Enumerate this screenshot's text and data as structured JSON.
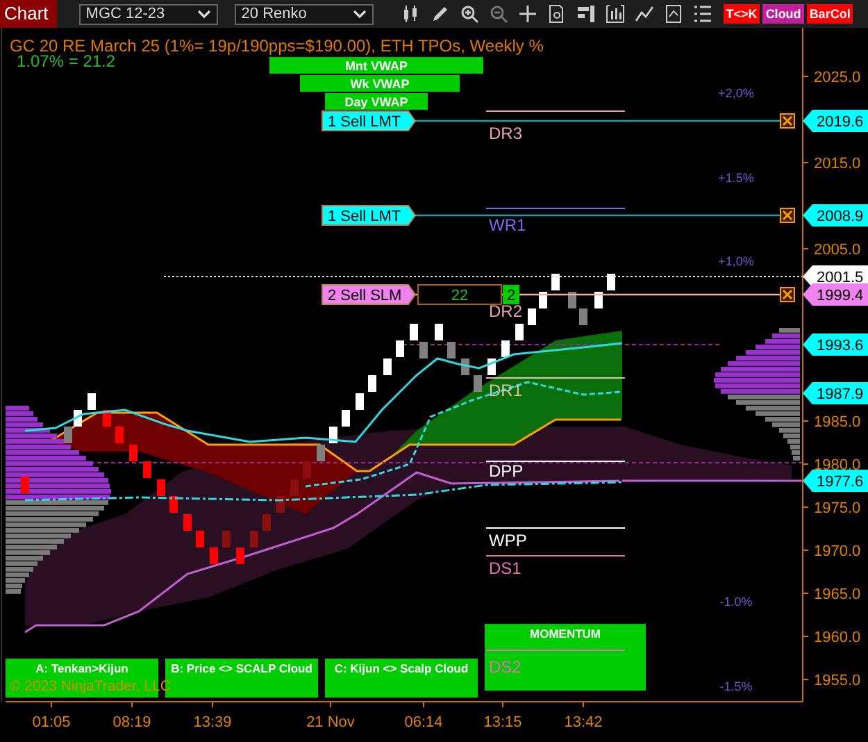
{
  "toolbar": {
    "title": "Chart",
    "instrument": "MGC 12-23",
    "bar_type": "20 Renko",
    "toggles": [
      {
        "label": "T<>K",
        "color": "#ff0000"
      },
      {
        "label": "Cloud",
        "color": "#c0209a"
      },
      {
        "label": "BarCol",
        "color": "#ff0000"
      }
    ]
  },
  "chart": {
    "header": "GC 20 RE March 25 (1%= 19p/190pps=$190.00), ETH TPOs, Weekly %",
    "subheader": "1.07% = 21.2",
    "vwap_labels": [
      "Mnt VWAP",
      "Wk VWAP",
      "Day VWAP"
    ],
    "orders": [
      {
        "label": "1 Sell LMT",
        "kind": "limit"
      },
      {
        "label": "1 Sell LMT",
        "kind": "limit"
      },
      {
        "label": "2 Sell SLM",
        "kind": "stop",
        "quantity": "22",
        "count": "2"
      }
    ],
    "pivots": [
      {
        "label": "DR3",
        "color": "#e8a0b0"
      },
      {
        "label": "WR1",
        "color": "#7b68ee"
      },
      {
        "label": "DR2",
        "color": "#e8a0b0"
      },
      {
        "label": "DR1",
        "color": "#e0c0a8"
      },
      {
        "label": "DPP",
        "color": "#ffffff"
      },
      {
        "label": "WPP",
        "color": "#ffffff"
      },
      {
        "label": "DS1",
        "color": "#e070b0"
      },
      {
        "label": "DS2",
        "color": "#e070b0"
      }
    ],
    "percent_labels": [
      "+2,0%",
      "+1.5%",
      "+1,0%",
      "-1.0%",
      "-1.5%"
    ],
    "signals": [
      "A: Tenkan>Kijun",
      "B: Price <> SCALP Cloud",
      "C: Kijun <> Scalp Cloud",
      "MOMENTUM"
    ],
    "copyright": "© 2023 NinjaTrader, LLC",
    "price_ticks": [
      "2025.0",
      "2015.0",
      "2005.0",
      "1985.0",
      "1980.0",
      "1975.0",
      "1970.0",
      "1965.0",
      "1960.0",
      "1955.0"
    ],
    "price_markers": [
      {
        "price": "2019.6",
        "color": "#00ffff"
      },
      {
        "price": "2008.9",
        "color": "#00ffff"
      },
      {
        "price": "2001.5",
        "color": "#ffffff"
      },
      {
        "price": "1999.4",
        "color": "#ee82ee"
      },
      {
        "price": "1993.6",
        "color": "#00ffff"
      },
      {
        "price": "1987.9",
        "color": "#00ffff"
      },
      {
        "price": "1977.6",
        "color": "#00ffff"
      }
    ],
    "time_labels": [
      "01:05",
      "08:19",
      "13:39",
      "21 Nov",
      "06:14",
      "13:15",
      "13:42"
    ]
  }
}
